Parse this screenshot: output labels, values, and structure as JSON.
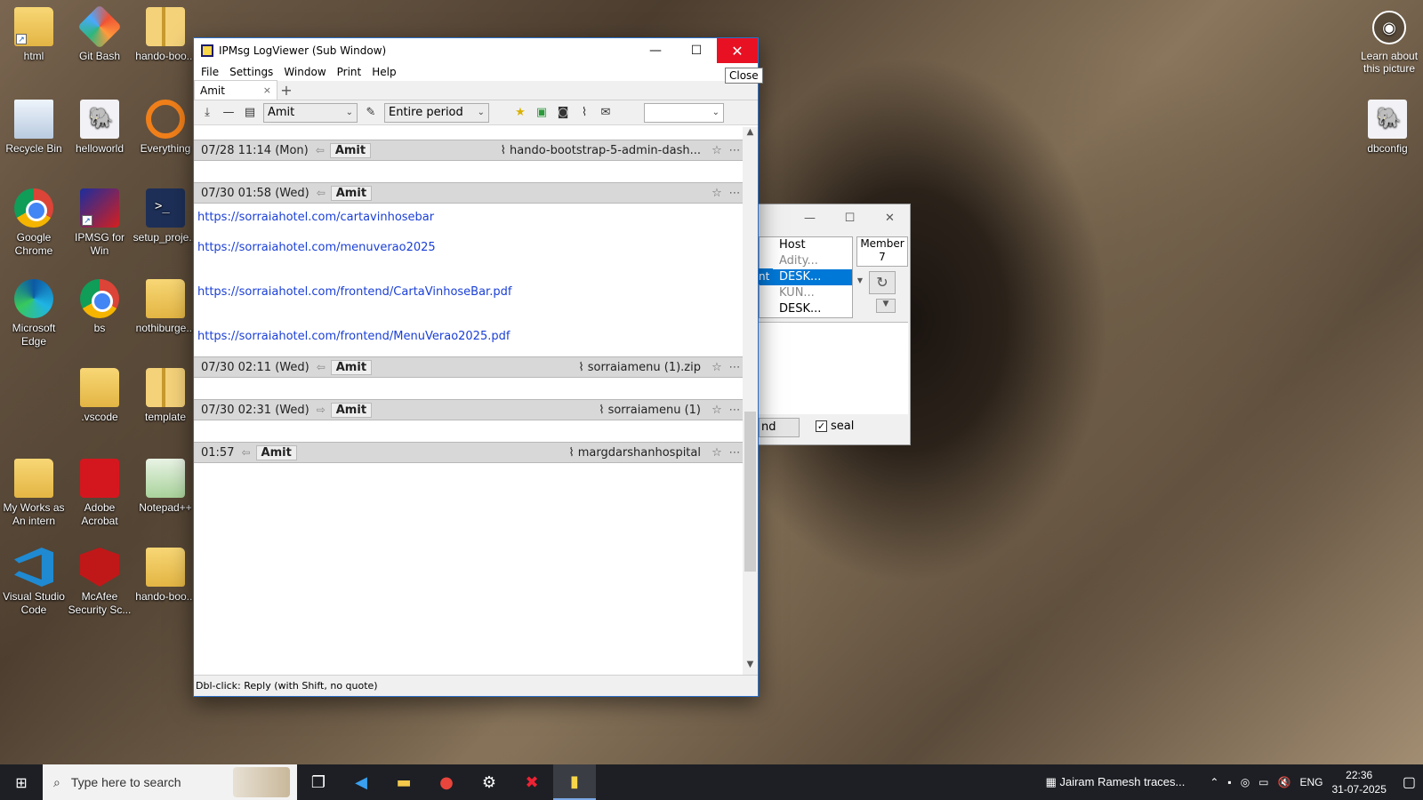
{
  "desktop": {
    "icons_left": [
      {
        "label": "html",
        "kind": "folder"
      },
      {
        "label": "Git Bash",
        "kind": "gitbash"
      },
      {
        "label": "hando-boo...",
        "kind": "zip"
      },
      {
        "label": "",
        "kind": "zip"
      },
      {
        "label": "Recycle Bin",
        "kind": "recycle"
      },
      {
        "label": "helloworld",
        "kind": "php"
      },
      {
        "label": "Everything",
        "kind": "everything"
      },
      {
        "label": "Google Chrome",
        "kind": "chrome"
      },
      {
        "label": "IPMSG for Win",
        "kind": "ipmsg"
      },
      {
        "label": "setup_proje...",
        "kind": "ps"
      },
      {
        "label": "Microsoft Edge",
        "kind": "edge"
      },
      {
        "label": "bs",
        "kind": "chrome"
      },
      {
        "label": "nothiburge...",
        "kind": "folder"
      },
      {
        "label": ".vscode",
        "kind": "folder"
      },
      {
        "label": "template",
        "kind": "zip"
      },
      {
        "label": "My Works as An intern",
        "kind": "folder"
      },
      {
        "label": "Adobe Acrobat",
        "kind": "acrobat"
      },
      {
        "label": "Notepad++",
        "kind": "notepad"
      },
      {
        "label": "Visual Studio Code",
        "kind": "vscode"
      },
      {
        "label": "McAfee Security Sc...",
        "kind": "mcafee"
      },
      {
        "label": "hando-boo...",
        "kind": "folder"
      }
    ],
    "learn_label": "Learn about this picture",
    "dbconfig_label": "dbconfig"
  },
  "logviewer": {
    "title": "IPMsg LogViewer (Sub Window)",
    "menu": [
      "File",
      "Settings",
      "Window",
      "Print",
      "Help"
    ],
    "tab_label": "Amit",
    "tab_close": "×",
    "tab_add": "+",
    "user_combo": "Amit",
    "period_combo": "Entire period",
    "search_combo": "",
    "close_tooltip": "Close",
    "status_text": "Dbl-click: Reply (with Shift, no quote)",
    "entries": [
      {
        "date": "07/28 11:14 (Mon)",
        "dir": "⇦",
        "who": "Amit",
        "file": "hando-bootstrap-5-admin-dash..."
      },
      {
        "date": "07/30 01:58 (Wed)",
        "dir": "⇦",
        "who": "Amit",
        "file": ""
      },
      {
        "date": "07/30 02:11 (Wed)",
        "dir": "⇦",
        "who": "Amit",
        "file": "sorraiamenu (1).zip"
      },
      {
        "date": "07/30 02:31 (Wed)",
        "dir": "⇨",
        "who": "Amit",
        "file": "sorraiamenu (1)"
      },
      {
        "date": "01:57",
        "dir": "⇦",
        "who": "Amit",
        "file": "margdarshanhospital"
      }
    ],
    "links": [
      "https://sorraiahotel.com/cartavinhosebar",
      "https://sorraiahotel.com/menuverao2025",
      "https://sorraiahotel.com/frontend/CartaVinhoseBar.pdf",
      "https://sorraiahotel.com/frontend/MenuVerao2025.pdf"
    ]
  },
  "sendwindow": {
    "hosts_header": "Host",
    "hosts": [
      "Adity...",
      "DESK...",
      "KUN...",
      "DESK..."
    ],
    "selected_left": "nt",
    "member_label": "Member",
    "member_count": "7",
    "send_label": "nd",
    "seal_label": "seal"
  },
  "taskbar": {
    "search_placeholder": "Type here to search",
    "news": "Jairam Ramesh traces...",
    "lang": "ENG",
    "time": "22:36",
    "date": "31-07-2025"
  }
}
